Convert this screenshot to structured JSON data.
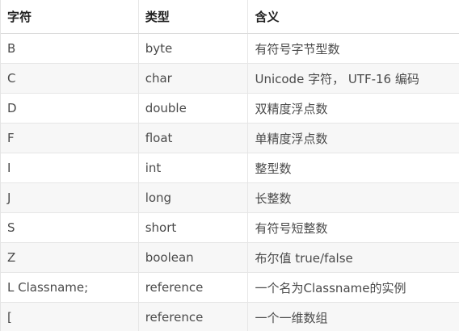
{
  "table": {
    "headers": [
      "字符",
      "类型",
      "含义"
    ],
    "rows": [
      [
        "B",
        "byte",
        "有符号字节型数"
      ],
      [
        "C",
        "char",
        "Unicode 字符， UTF-16 编码"
      ],
      [
        "D",
        "double",
        "双精度浮点数"
      ],
      [
        "F",
        "float",
        "单精度浮点数"
      ],
      [
        "I",
        "int",
        "整型数"
      ],
      [
        "J",
        "long",
        "长整数"
      ],
      [
        "S",
        "short",
        "有符号短整数"
      ],
      [
        "Z",
        "boolean",
        "布尔值 true/false"
      ],
      [
        "L Classname;",
        "reference",
        "一个名为Classname的实例"
      ],
      [
        "[",
        "reference",
        "一个一维数组"
      ]
    ]
  }
}
